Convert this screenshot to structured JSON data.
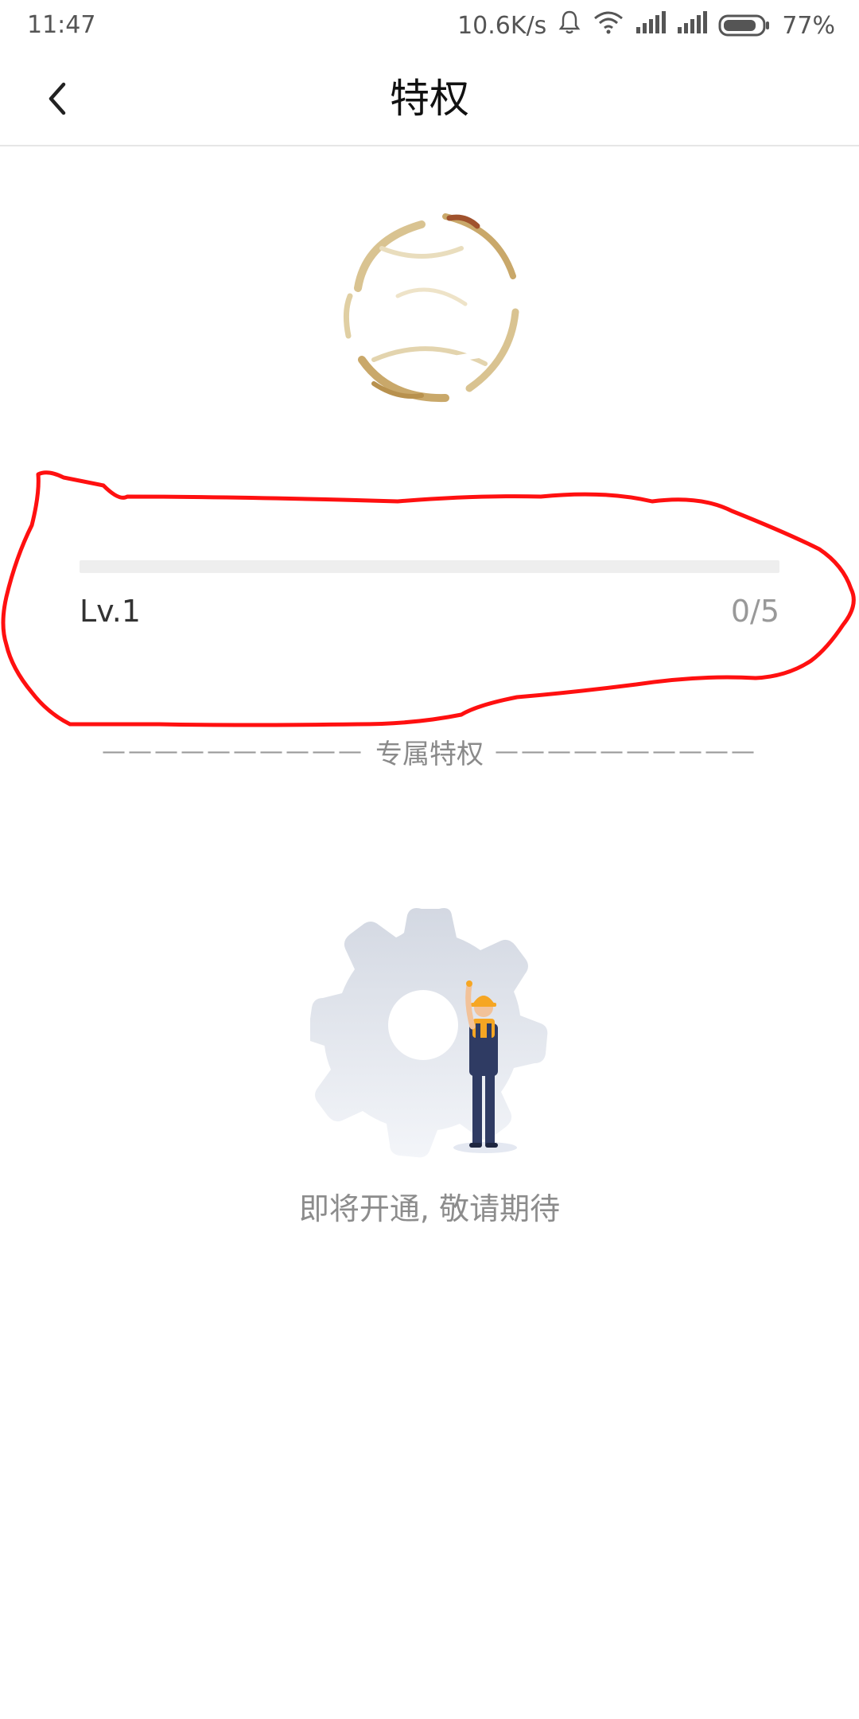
{
  "status_bar": {
    "time": "11:47",
    "network_speed": "10.6K/s",
    "battery_percent": "77%",
    "icons": [
      "bell-icon",
      "wifi-icon",
      "signal-icon",
      "signal-icon",
      "battery-icon"
    ]
  },
  "header": {
    "back_icon": "chevron-left-icon",
    "title": "特权"
  },
  "profile": {
    "avatar": "avatar-image",
    "username": ""
  },
  "level": {
    "label": "Lv.1",
    "progress_text": "0/5",
    "progress_fraction": 0
  },
  "section": {
    "dashes": "——————————",
    "title": "专属特权"
  },
  "empty_state": {
    "illustration": "gear-worker-illustration",
    "message": "即将开通, 敬请期待"
  },
  "colors": {
    "annotation": "#ff1010",
    "track": "#eeeeee",
    "title_text": "#111111",
    "muted_text": "#8c8c8c"
  }
}
